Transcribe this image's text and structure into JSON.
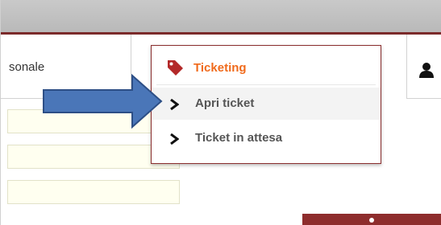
{
  "tabs": {
    "personale": {
      "label": "sonale"
    },
    "user": {
      "icon": "user-icon"
    }
  },
  "dropdown": {
    "title": "Ticketing",
    "title_icon": "tag-icon",
    "items": [
      {
        "label": "Apri ticket",
        "icon": "chevron-right-icon"
      },
      {
        "label": "Ticket in attesa",
        "icon": "chevron-right-icon"
      }
    ]
  },
  "annotation": {
    "icon": "blue-arrow-icon",
    "color": "#4a76b8"
  },
  "colors": {
    "accent": "#f06a1b",
    "brand": "#8a2e2e",
    "field_bg": "#fffff0"
  }
}
